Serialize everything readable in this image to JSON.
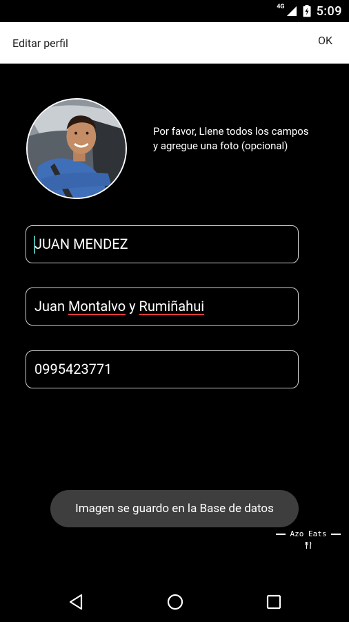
{
  "status_bar": {
    "network": "4G",
    "time": "5:09",
    "icons": [
      "signal-icon",
      "battery-icon"
    ]
  },
  "app_bar": {
    "title": "Editar perfil",
    "ok_label": "OK"
  },
  "profile": {
    "instructions": "Por favor, Llene todos los campos y agregue una foto (opcional)"
  },
  "form": {
    "name": {
      "value": "JUAN MENDEZ"
    },
    "address": {
      "parts": [
        "Juan ",
        "Montalvo",
        " y ",
        "Rumiñahui"
      ]
    },
    "phone": {
      "value": "0995423771"
    }
  },
  "toast": {
    "message": "Imagen se guardo en la Base de datos"
  },
  "watermark": {
    "text": "Azo Eats",
    "icon": "fork-knife-icon"
  },
  "nav_bar": {
    "icons": [
      "back-icon",
      "home-icon",
      "recents-icon"
    ]
  },
  "colors": {
    "background": "#000000",
    "app_bar": "#ffffff",
    "field_border": "#cfcfcf",
    "toast_bg": "#3e3e3e",
    "spellcheck_underline": "#e53935",
    "cursor": "#4db6ac"
  }
}
